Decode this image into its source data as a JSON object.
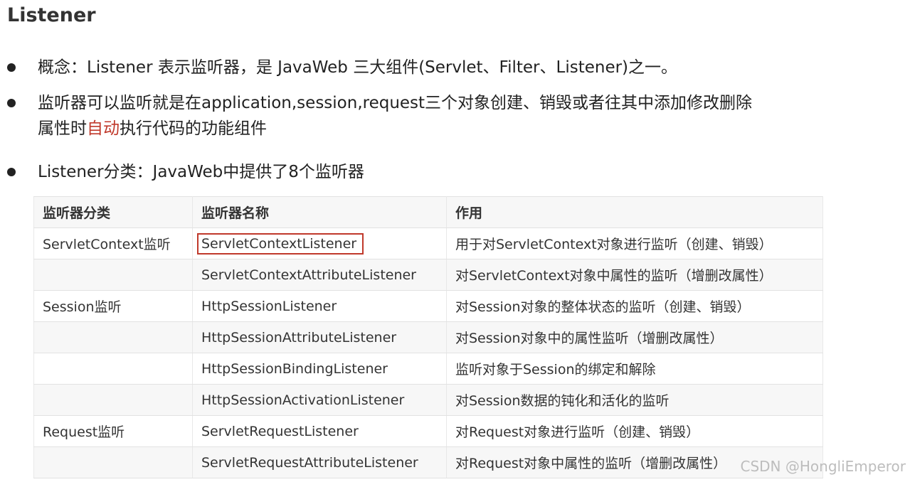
{
  "title": "Listener",
  "bullets": {
    "b1": "概念：Listener 表示监听器，是 JavaWeb 三大组件(Servlet、Filter、Listener)之一。",
    "b2_line1": "监听器可以监听就是在application,session,request三个对象创建、销毁或者往其中添加修改删除",
    "b2_line2_pre": "属性时",
    "b2_line2_red": "自动",
    "b2_line2_post": "执行代码的功能组件",
    "b3": "Listener分类：JavaWeb中提供了8个监听器"
  },
  "table": {
    "headers": [
      "监听器分类",
      "监听器名称",
      "作用"
    ],
    "rows": [
      [
        "ServletContext监听",
        "ServletContextListener",
        "用于对ServletContext对象进行监听（创建、销毁）"
      ],
      [
        "",
        "ServletContextAttributeListener",
        "对ServletContext对象中属性的监听（增删改属性）"
      ],
      [
        "Session监听",
        "HttpSessionListener",
        "对Session对象的整体状态的监听（创建、销毁）"
      ],
      [
        "",
        "HttpSessionAttributeListener",
        "对Session对象中的属性监听（增删改属性）"
      ],
      [
        "",
        "HttpSessionBindingListener",
        "监听对象于Session的绑定和解除"
      ],
      [
        "",
        "HttpSessionActivationListener",
        "对Session数据的钝化和活化的监听"
      ],
      [
        "Request监听",
        "ServletRequestListener",
        "对Request对象进行监听（创建、销毁）"
      ],
      [
        "",
        "ServletRequestAttributeListener",
        "对Request对象中属性的监听（增删改属性）"
      ]
    ]
  },
  "watermark": "CSDN @HongliEmperor",
  "colors": {
    "accent_red": "#c0392b"
  }
}
